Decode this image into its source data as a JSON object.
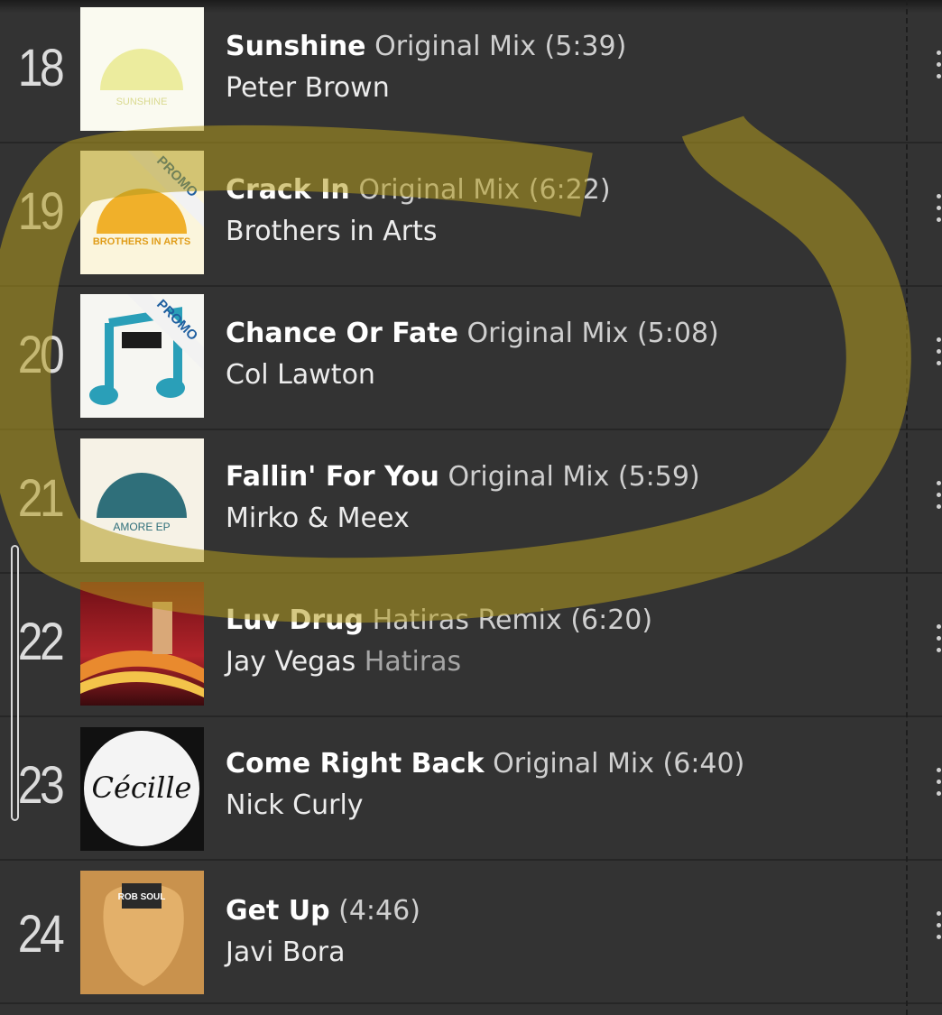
{
  "tracks": [
    {
      "position": "18",
      "title": "Sunshine",
      "mix": "Original Mix",
      "duration": "(5:39)",
      "artist": "Peter Brown",
      "remixer": "",
      "cover_text": "SUNSHINE",
      "promo": false
    },
    {
      "position": "19",
      "title": "Crack In",
      "mix": "Original Mix",
      "duration": "(6:22)",
      "artist": "Brothers in Arts",
      "remixer": "",
      "cover_text": "BROTHERS IN ARTS",
      "promo": true
    },
    {
      "position": "20",
      "title": "Chance Or Fate",
      "mix": "Original Mix",
      "duration": "(5:08)",
      "artist": "Col Lawton",
      "remixer": "",
      "cover_text": "",
      "promo": true
    },
    {
      "position": "21",
      "title": "Fallin' For You",
      "mix": "Original Mix",
      "duration": "(5:59)",
      "artist": "Mirko & Meex",
      "remixer": "",
      "cover_text": "AMORE EP",
      "promo": false
    },
    {
      "position": "22",
      "title": "Luv Drug",
      "mix": "Hatiras Remix",
      "duration": "(6:20)",
      "artist": "Jay Vegas",
      "remixer": "Hatiras",
      "cover_text": "",
      "promo": false
    },
    {
      "position": "23",
      "title": "Come Right Back",
      "mix": "Original Mix",
      "duration": "(6:40)",
      "artist": "Nick Curly",
      "remixer": "",
      "cover_text": "Cécille",
      "promo": false
    },
    {
      "position": "24",
      "title": "Get Up",
      "mix": "",
      "duration": "(4:46)",
      "artist": "Javi Bora",
      "remixer": "",
      "cover_text": "ROB SOUL",
      "promo": false
    }
  ],
  "promo_label": "PROMO",
  "icons": {
    "row_menu": "more-vertical-icon"
  },
  "colors": {
    "background": "#333333",
    "highlight": "#b29a1e",
    "text": "#ffffff",
    "muted": "#cfcfcf"
  }
}
